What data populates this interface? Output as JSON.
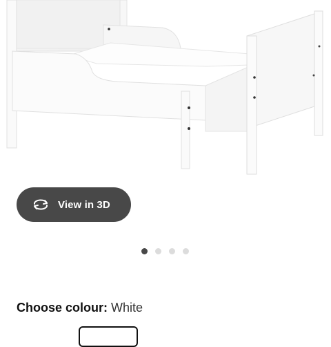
{
  "product": {
    "image_alt": "White extendable bed frame"
  },
  "view3d": {
    "label": "View in 3D",
    "icon": "rotate-3d-icon"
  },
  "carousel": {
    "dot_count": 4,
    "active_index": 0
  },
  "colour": {
    "label": "Choose colour:",
    "value": "White"
  },
  "colors": {
    "button_bg": "#484848",
    "dot_active": "#484848",
    "dot_inactive": "#dcdcdc",
    "frame_white": "#fbfbfb",
    "frame_edge": "#e3e3e3"
  }
}
